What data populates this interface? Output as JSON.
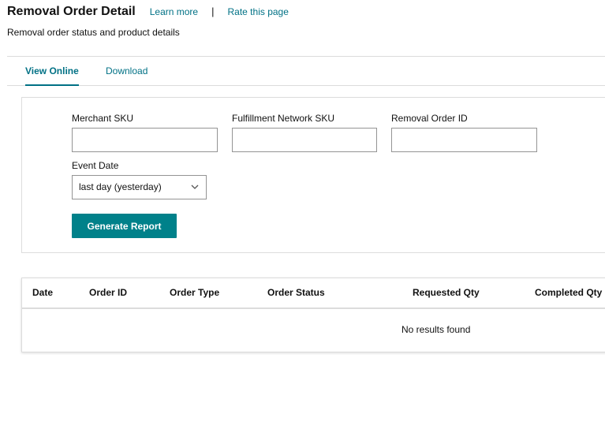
{
  "header": {
    "title": "Removal Order Detail",
    "learn_more": "Learn more",
    "separator": "|",
    "rate_page": "Rate this page",
    "subtitle": "Removal order status and product details"
  },
  "tabs": [
    {
      "label": "View Online",
      "active": true
    },
    {
      "label": "Download",
      "active": false
    }
  ],
  "filters": {
    "merchant_sku": {
      "label": "Merchant SKU",
      "value": ""
    },
    "fnsku": {
      "label": "Fulfillment Network SKU",
      "value": ""
    },
    "removal_order_id": {
      "label": "Removal Order ID",
      "value": ""
    },
    "event_date": {
      "label": "Event Date",
      "selected": "last day (yesterday)"
    },
    "generate_button": "Generate Report"
  },
  "results": {
    "columns": [
      "Date",
      "Order ID",
      "Order Type",
      "Order Status",
      "Requested Qty",
      "Completed Qty"
    ],
    "empty_message": "No results found"
  },
  "colors": {
    "link": "#007185",
    "button": "#00818a",
    "border": "#dcdcdc"
  },
  "icons": {
    "select_arrow": "chevron-down-icon"
  }
}
